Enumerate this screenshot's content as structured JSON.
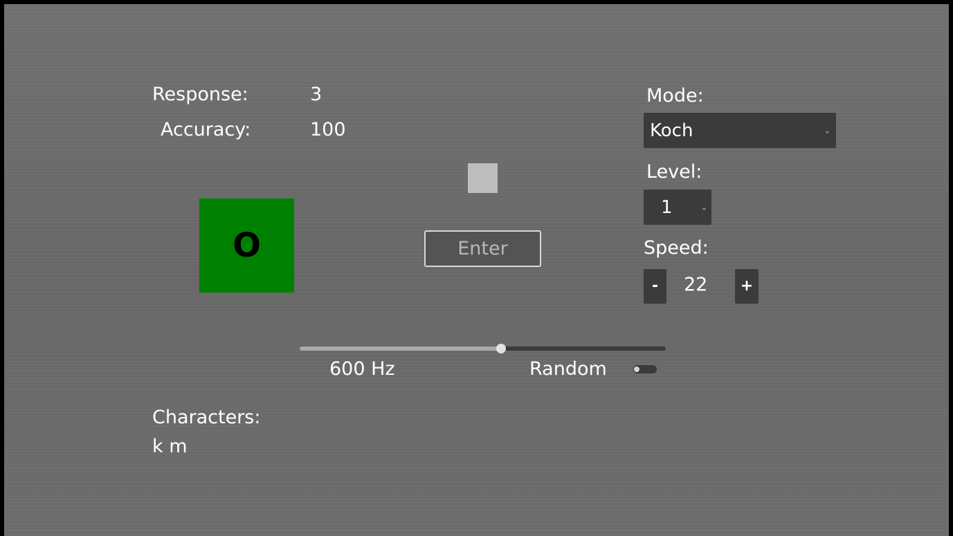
{
  "stats": {
    "response_label": "Response:",
    "response_value": "3",
    "accuracy_label": "Accuracy:",
    "accuracy_value": "100"
  },
  "target": {
    "character": "O",
    "color": "#008000"
  },
  "status_square": {
    "color": "#bdbdbd"
  },
  "entry": {
    "placeholder": "Enter"
  },
  "mode": {
    "label": "Mode:",
    "selected": "Koch"
  },
  "level": {
    "label": "Level:",
    "selected": "1"
  },
  "speed": {
    "label": "Speed:",
    "value": "22",
    "minus_label": "-",
    "plus_label": "+"
  },
  "tone": {
    "frequency_label": "600 Hz",
    "slider_fraction": 0.55,
    "random_label": "Random",
    "random_enabled": false
  },
  "characters": {
    "label": "Characters:",
    "list": "k m"
  },
  "icons": {
    "select_chevron": "chevron-down-icon"
  }
}
